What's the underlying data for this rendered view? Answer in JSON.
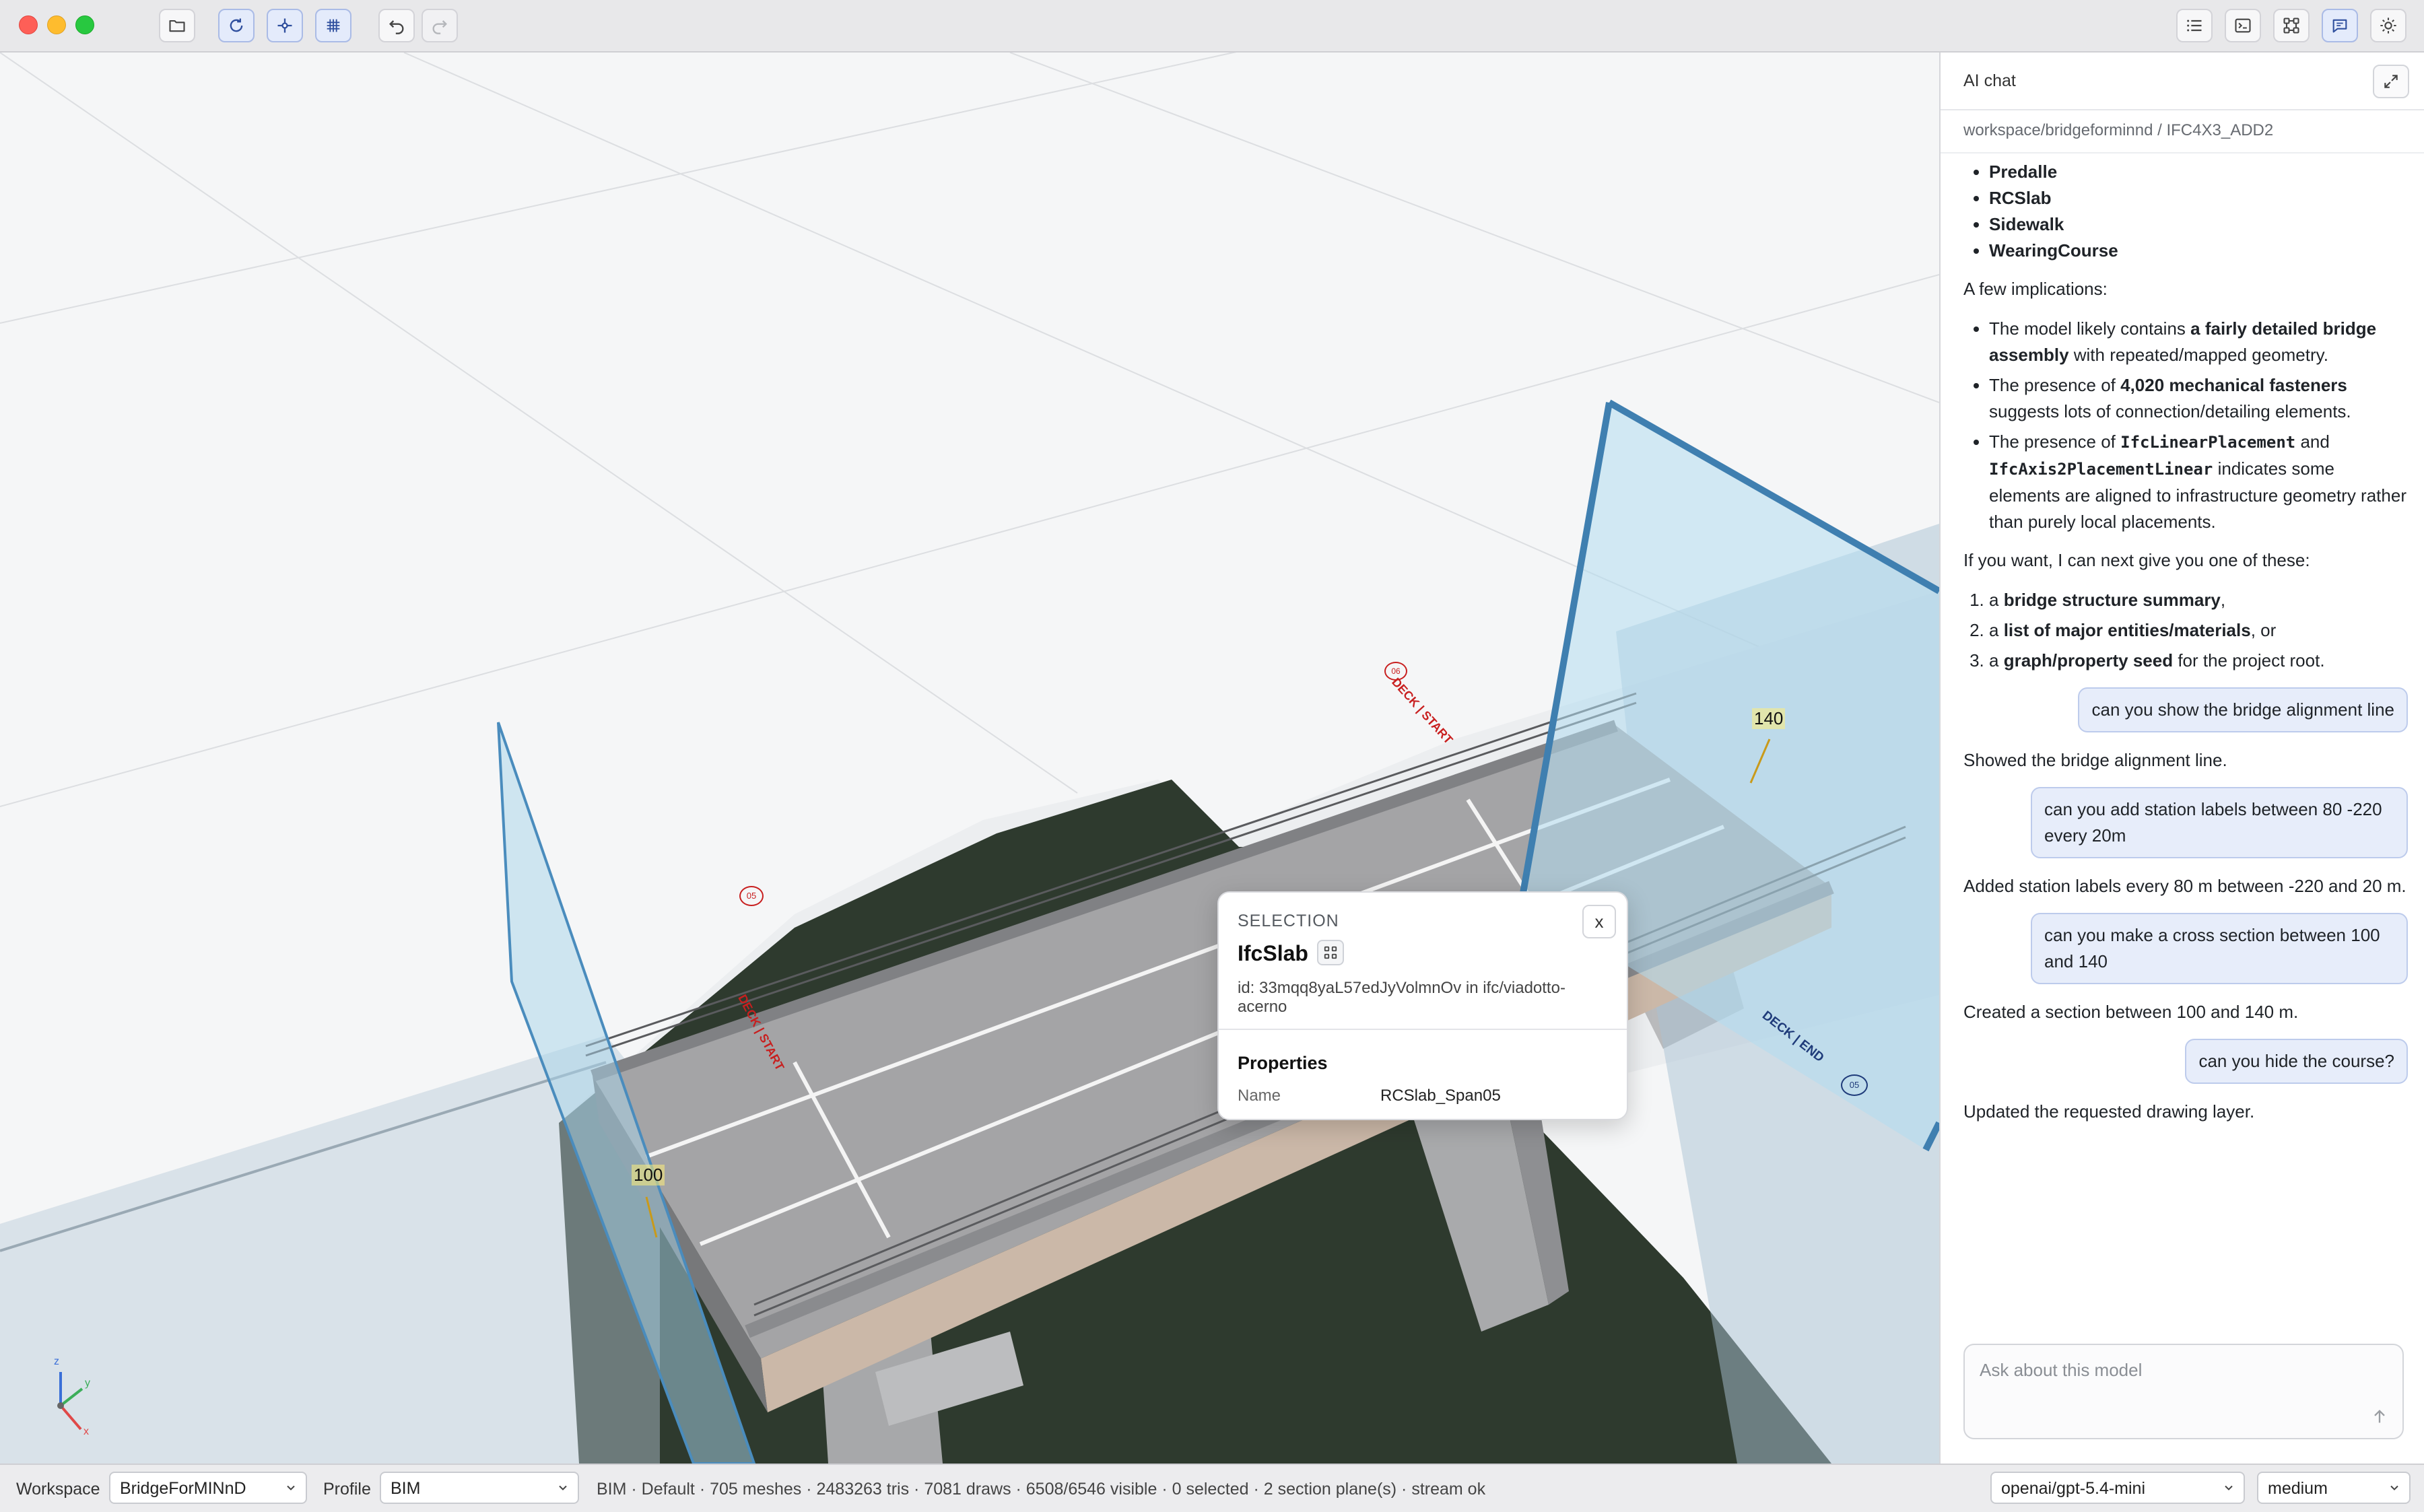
{
  "titlebar": {
    "left_tools": [
      "folder-icon",
      "refresh-icon",
      "crosshair-icon",
      "grid-icon",
      "undo-icon",
      "redo-icon"
    ],
    "right_tools": [
      "list-icon",
      "terminal-icon",
      "graph-icon",
      "chat-icon",
      "sun-icon"
    ]
  },
  "viewport": {
    "labels": {
      "deck_start_1": "DECK | START",
      "deck_start_2": "DECK | START",
      "deck_end": "DECK | END",
      "section_near": "100",
      "section_far": "140",
      "badge_start": "05",
      "badge_end": "05",
      "badge_top": "06"
    },
    "axes": {
      "x": "x",
      "y": "y",
      "z": "z"
    }
  },
  "selection": {
    "header": "SELECTION",
    "class_name": "IfcSlab",
    "close_label": "x",
    "id_text": "id: 33mqq8yaL57edJyVolmnOv in ifc/viadotto-acerno",
    "properties_title": "Properties",
    "prop_name_key": "Name",
    "prop_name_value": "RCSlab_Span05"
  },
  "chat": {
    "title": "AI chat",
    "path": "workspace/bridgeforminnd / IFC4X3_ADD2",
    "list1": [
      "Predalle",
      "RCSlab",
      "Sidewalk",
      "WearingCourse"
    ],
    "implications_intro": "A few implications:",
    "imp1": {
      "a": "The model likely contains ",
      "b": "a fairly detailed bridge assembly",
      "c": " with repeated/mapped geometry."
    },
    "imp2": {
      "a": "The presence of ",
      "b": "4,020 mechanical fasteners",
      "c": " suggests lots of connection/detailing elements."
    },
    "imp3": {
      "a": "The presence of ",
      "code1": "IfcLinearPlacement",
      "b": " and ",
      "code2": "IfcAxis2PlacementLinear",
      "c": " indicates some elements are aligned to infrastructure geometry rather than purely local placements."
    },
    "offer_intro": "If you want, I can next give you one of these:",
    "opt1": {
      "a": "a ",
      "b": "bridge structure summary",
      "c": ","
    },
    "opt2": {
      "a": "a ",
      "b": "list of major entities/materials",
      "c": ", or"
    },
    "opt3": {
      "a": "a ",
      "b": "graph/property seed",
      "c": " for the project root."
    },
    "conversation": [
      {
        "role": "user",
        "text": "can you show the bridge alignment line"
      },
      {
        "role": "assistant",
        "text": "Showed the bridge alignment line."
      },
      {
        "role": "user",
        "text": "can you add station labels between 80 -220 every 20m"
      },
      {
        "role": "assistant",
        "text": "Added station labels every 80 m between -220 and 20 m."
      },
      {
        "role": "user",
        "text": "can you make a cross section between 100 and 140"
      },
      {
        "role": "assistant",
        "text": "Created a section between 100 and 140 m."
      },
      {
        "role": "user",
        "text": "can you hide the course?"
      },
      {
        "role": "assistant",
        "text": "Updated the requested drawing layer."
      }
    ],
    "composer_placeholder": "Ask about this model"
  },
  "statusbar": {
    "workspace_label": "Workspace",
    "workspace_value": "BridgeForMINnD",
    "profile_label": "Profile",
    "profile_value": "BIM",
    "stats": "BIM · Default · 705 meshes · 2483263 tris · 7081 draws · 6508/6546 visible · 0 selected · 2 section plane(s) · stream ok",
    "model_value": "openai/gpt-5.4-mini",
    "effort_value": "medium"
  }
}
